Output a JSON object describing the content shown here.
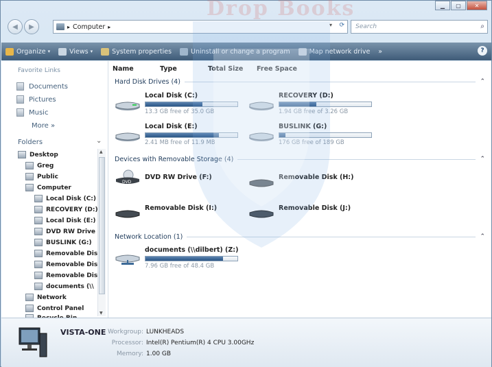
{
  "watermark": "Drop Books",
  "address": {
    "location": "Computer",
    "search_placeholder": "Search"
  },
  "toolbar": {
    "organize": "Organize",
    "views": "Views",
    "system_properties": "System properties",
    "uninstall": "Uninstall or change a program",
    "map_drive": "Map network drive",
    "overflow": "»",
    "help": "?"
  },
  "nav": {
    "favorite_links_title": "Favorite Links",
    "favorites": [
      "Documents",
      "Pictures",
      "Music"
    ],
    "more": "More »",
    "folders_title": "Folders",
    "tree": [
      "Desktop",
      "Greg",
      "Public",
      "Computer",
      "Local Disk (C:)",
      "RECOVERY (D:)",
      "Local Disk (E:)",
      "DVD RW Drive",
      "BUSLINK (G:)",
      "Removable Dis",
      "Removable Dis",
      "Removable Dis",
      "documents (\\\\",
      "Network",
      "Control Panel",
      "Recycle Bin"
    ]
  },
  "columns": [
    "Name",
    "Type",
    "Total Size",
    "Free Space"
  ],
  "groups": {
    "hdd": "Hard Disk Drives (4)",
    "removable": "Devices with Removable Storage (4)",
    "network": "Network Location (1)"
  },
  "drives": [
    {
      "name": "Local Disk (C:)",
      "free": "13.3 GB free of 35.0 GB",
      "used_fraction": 0.62
    },
    {
      "name": "RECOVERY (D:)",
      "free": "1.94 GB free of 3.26 GB",
      "used_fraction": 0.4
    },
    {
      "name": "Local Disk (E:)",
      "free": "2.41 MB free of 11.9 MB",
      "used_fraction": 0.8
    },
    {
      "name": "BUSLINK (G:)",
      "free": "176 GB free of 189 GB",
      "used_fraction": 0.07
    }
  ],
  "removable": [
    "DVD RW Drive (F:)",
    "Removable Disk (H:)",
    "Removable Disk (I:)",
    "Removable Disk (J:)"
  ],
  "network_drive": {
    "name": "documents (\\\\dilbert) (Z:)",
    "free": "7.96 GB free of 48.4 GB",
    "used_fraction": 0.84
  },
  "details": {
    "computer_name": "VISTA-ONE",
    "workgroup_label": "Workgroup:",
    "workgroup": "LUNKHEADS",
    "processor_label": "Processor:",
    "processor": "Intel(R) Pentium(R) 4 CPU 3.00GHz",
    "memory_label": "Memory:",
    "memory": "1.00 GB"
  }
}
